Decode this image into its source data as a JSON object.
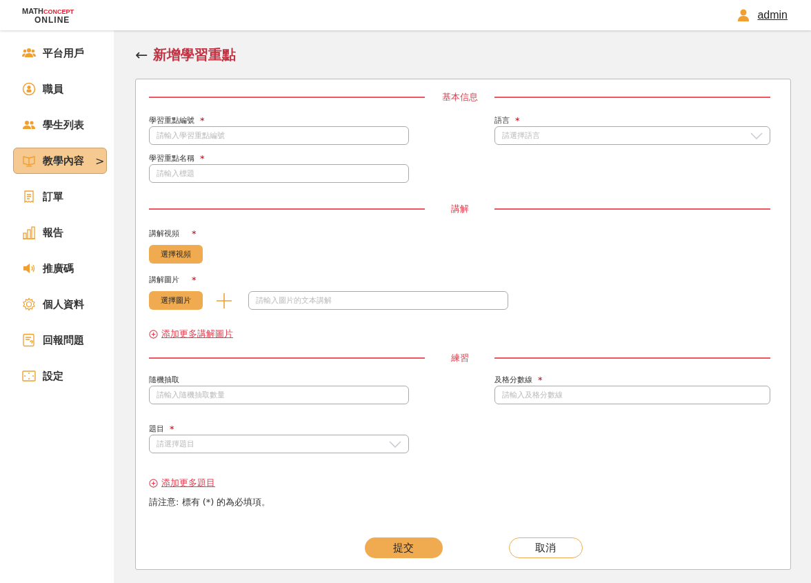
{
  "header": {
    "logo": {
      "line_1a": "MATH",
      "line_1b": "CONCEPT",
      "line_2": "ONLINE"
    },
    "user": "admin"
  },
  "sidebar": {
    "items": [
      {
        "label": "平台用戶",
        "selected": false
      },
      {
        "label": "職員",
        "selected": false
      },
      {
        "label": "學生列表",
        "selected": false
      },
      {
        "label": "教學內容",
        "selected": true,
        "chevron": ">"
      },
      {
        "label": "訂單",
        "selected": false
      },
      {
        "label": "報告",
        "selected": false
      },
      {
        "label": "推廣碼",
        "selected": false
      },
      {
        "label": "個人資料",
        "selected": false
      },
      {
        "label": "回報問題",
        "selected": false
      },
      {
        "label": "設定",
        "selected": false
      }
    ]
  },
  "page": {
    "back": "←",
    "title": "新增學習重點"
  },
  "sections": [
    {
      "title": "基本信息",
      "items": [
        {
          "kind": "fields",
          "fields": [
            {
              "label": "學習重點編號",
              "required_mark": "*",
              "kind": "input",
              "placeholder": "請輸入學習重點編號"
            },
            {
              "label": "語言",
              "required_mark": "*",
              "kind": "select",
              "placeholder": "請選擇語言"
            }
          ]
        },
        {
          "kind": "fields",
          "fields": [
            {
              "label": "學習重點名稱",
              "required_mark": "*",
              "kind": "input",
              "placeholder": "請輸入標題"
            }
          ]
        }
      ]
    },
    {
      "title": "講解",
      "items": [
        {
          "kind": "upload",
          "label": "講解視頻",
          "required_mark": "*",
          "button": "選擇視頻"
        },
        {
          "kind": "upload",
          "label": "講解圖片",
          "required_mark": "*",
          "button": "選擇圖片",
          "placeholder": "請輸入圖片的文本講解"
        },
        {
          "kind": "add-link",
          "text": "添加更多講解圖片"
        }
      ]
    },
    {
      "title": "練習",
      "items": [
        {
          "kind": "fields",
          "fields": [
            {
              "label": "隨機抽取",
              "kind": "input",
              "placeholder": "請輸入隨機抽取數量"
            },
            {
              "label": "及格分數線",
              "required_mark": "*",
              "kind": "input",
              "placeholder": "請輸入及格分數線"
            }
          ]
        },
        {
          "kind": "fields",
          "fields": [
            {
              "label": "題目",
              "required_mark": "*",
              "kind": "select",
              "placeholder": "請選擇題目"
            }
          ]
        },
        {
          "kind": "add-link",
          "text": "添加更多題目"
        }
      ]
    }
  ],
  "note": "請注意:  標有 (*) 的為必填項。",
  "buttons": [
    {
      "label": "提交",
      "kind": "primary"
    },
    {
      "label": "取消",
      "kind": "secondary"
    }
  ]
}
